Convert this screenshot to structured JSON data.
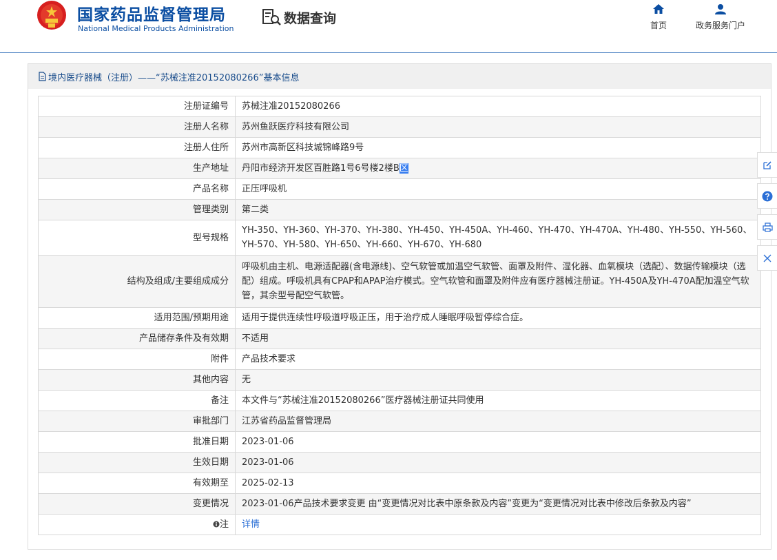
{
  "header": {
    "org_name_cn": "国家药品监督管理局",
    "org_name_en": "National Medical Products Administration",
    "query_label": "数据查询",
    "nav": [
      {
        "label": "首页",
        "icon": "home-icon"
      },
      {
        "label": "政务服务门户",
        "icon": "user-icon"
      }
    ]
  },
  "panel": {
    "title": "境内医疗器械（注册）——“苏械注准20152080266”基本信息"
  },
  "table": {
    "rows": [
      {
        "label": "注册证编号",
        "value": "苏械注准20152080266"
      },
      {
        "label": "注册人名称",
        "value": "苏州鱼跃医疗科技有限公司"
      },
      {
        "label": "注册人住所",
        "value": "苏州市高新区科技城锦峰路9号"
      },
      {
        "label": "生产地址",
        "value": "丹阳市经济开发区百胜路1号6号楼2楼B",
        "value_selected": "区"
      },
      {
        "label": "产品名称",
        "value": "正压呼吸机"
      },
      {
        "label": "管理类别",
        "value": "第二类"
      },
      {
        "label": "型号规格",
        "value": "YH-350、YH-360、YH-370、YH-380、YH-450、YH-450A、YH-460、YH-470、YH-470A、YH-480、YH-550、YH-560、YH-570、YH-580、YH-650、YH-660、YH-670、YH-680"
      },
      {
        "label": "结构及组成/主要组成成分",
        "value": "呼吸机由主机、电源适配器(含电源线)、空气软管或加温空气软管、面罩及附件、湿化器、血氧模块（选配）、数据传输模块（选配）组成。呼吸机具有CPAP和APAP治疗模式。空气软管和面罩及附件应有医疗器械注册证。YH-450A及YH-470A配加温空气软管，其余型号配空气软管。"
      },
      {
        "label": "适用范围/预期用途",
        "value": "适用于提供连续性呼吸道呼吸正压，用于治疗成人睡眠呼吸暂停综合症。"
      },
      {
        "label": "产品储存条件及有效期",
        "value": "不适用"
      },
      {
        "label": "附件",
        "value": "产品技术要求"
      },
      {
        "label": "其他内容",
        "value": "无"
      },
      {
        "label": "备注",
        "value": "本文件与“苏械注准20152080266”医疗器械注册证共同使用"
      },
      {
        "label": "审批部门",
        "value": "江苏省药品监督管理局"
      },
      {
        "label": "批准日期",
        "value": "2023-01-06"
      },
      {
        "label": "生效日期",
        "value": "2023-01-06"
      },
      {
        "label": "有效期至",
        "value": "2025-02-13"
      },
      {
        "label": "变更情况",
        "value": "2023-01-06产品技术要求变更 由“变更情况对比表中原条款及内容”变更为“变更情况对比表中修改后条款及内容”"
      },
      {
        "label": "注",
        "label_icon": "info-icon",
        "value": "详情"
      }
    ]
  },
  "side_tools": [
    {
      "icon": "edit-icon"
    },
    {
      "icon": "help-icon"
    },
    {
      "icon": "print-icon"
    },
    {
      "icon": "close-icon"
    }
  ],
  "colors": {
    "brand_blue": "#0b4ea2",
    "link_blue": "#2b6fd6",
    "row_alt_bg": "#f5f5f5",
    "selection_bg": "#3a7ff0"
  }
}
